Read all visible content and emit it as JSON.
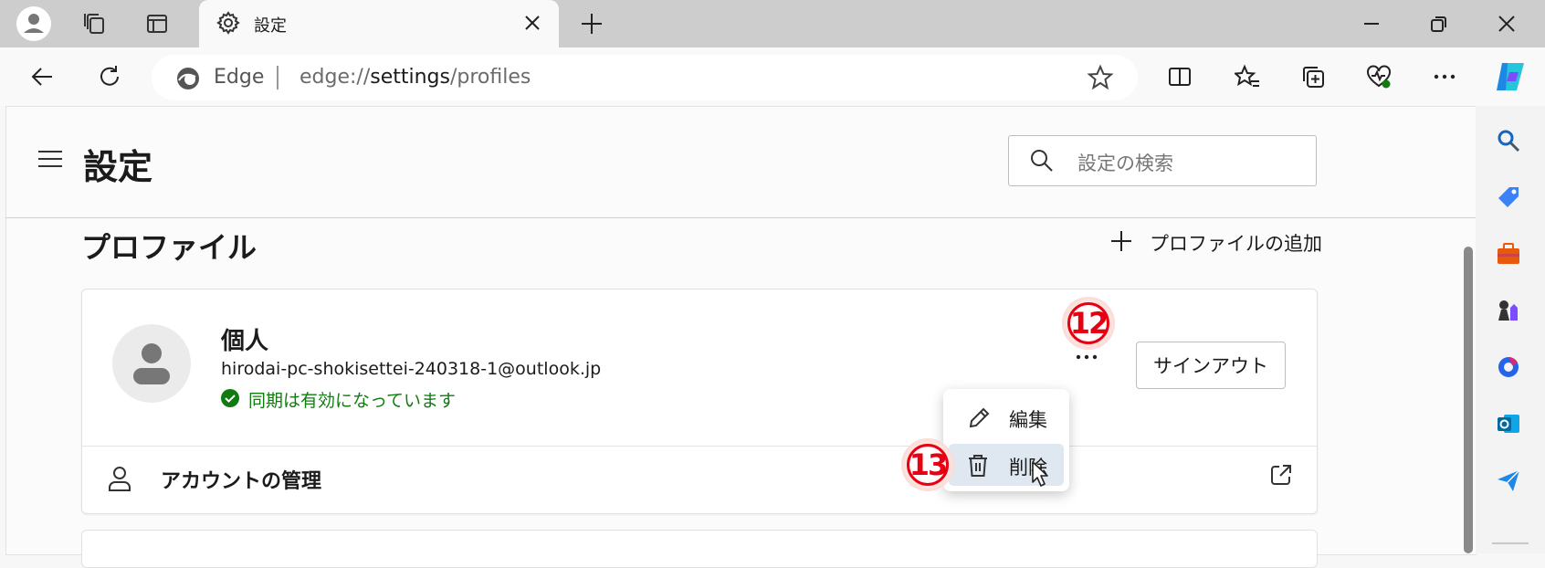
{
  "browser": {
    "tab": {
      "title": "設定"
    },
    "address": {
      "brand": "Edge",
      "url_scheme": "edge://",
      "url_host": "settings",
      "url_path": "/profiles"
    }
  },
  "settings": {
    "title": "設定",
    "search_placeholder": "設定の検索"
  },
  "profiles": {
    "section_title": "プロファイル",
    "add_label": "プロファイルの追加",
    "card": {
      "name": "個人",
      "email": "hirodai-pc-shokisettei-240318-1@outlook.jp",
      "sync_status": "同期は有効になっています",
      "signout_label": "サインアウト",
      "manage_label": "アカウントの管理"
    }
  },
  "context_menu": {
    "items": [
      {
        "label": "編集",
        "icon": "pencil-icon"
      },
      {
        "label": "削除",
        "icon": "trash-icon"
      }
    ]
  },
  "annotations": [
    "12",
    "13"
  ],
  "colors": {
    "sync_green": "#107c10",
    "annotation_red": "#e60012",
    "menu_hover": "#dfe8f1"
  }
}
